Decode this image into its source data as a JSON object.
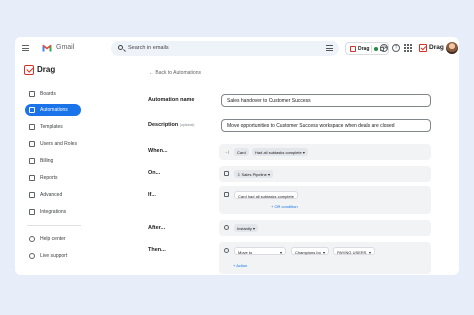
{
  "gmail": {
    "title": "Gmail"
  },
  "search": {
    "placeholder": "Search in emails"
  },
  "topbar": {
    "drag_chip_label": "Drag",
    "brand_label": "Drag"
  },
  "sidebar": {
    "brand": "Drag",
    "items": [
      {
        "label": "Boards",
        "icon": "board-icon"
      },
      {
        "label": "Automations",
        "icon": "automation-icon",
        "active": true
      },
      {
        "label": "Templates",
        "icon": "template-icon"
      },
      {
        "label": "Users and Roles",
        "icon": "users-icon"
      },
      {
        "label": "Billing",
        "icon": "billing-icon"
      },
      {
        "label": "Reports",
        "icon": "reports-icon"
      },
      {
        "label": "Advanced",
        "icon": "advanced-icon"
      },
      {
        "label": "Integrations",
        "icon": "integrations-icon"
      }
    ],
    "footer": [
      {
        "label": "Help center",
        "icon": "help-icon"
      },
      {
        "label": "Live support",
        "icon": "support-icon"
      }
    ]
  },
  "main": {
    "back": "Back to Automations",
    "name_label": "Automation name",
    "name_value": "Sales handover to Customer Success",
    "desc_label": "Description",
    "desc_optional": "(optional)",
    "desc_value": "Move opportunities to Customer Success workspace when deals are closed",
    "when_label": "When...",
    "when_card": "Card",
    "when_cond": "Had all subtasks complete",
    "on_label": "On...",
    "on_value": "Sales Pipeline",
    "if_label": "If...",
    "if_cond": "Card had all subtasks complete",
    "if_add": "+ OR condition",
    "after_label": "After...",
    "after_value": "Instantly",
    "then_label": "Then...",
    "then_action": "Move to",
    "then_board": "Champions bo",
    "then_column": "PAYING USERS",
    "then_add": "+ Action"
  },
  "colors": {
    "accent": "#1a73e8",
    "brand_red": "#d93025",
    "background": "#e7edf9"
  }
}
